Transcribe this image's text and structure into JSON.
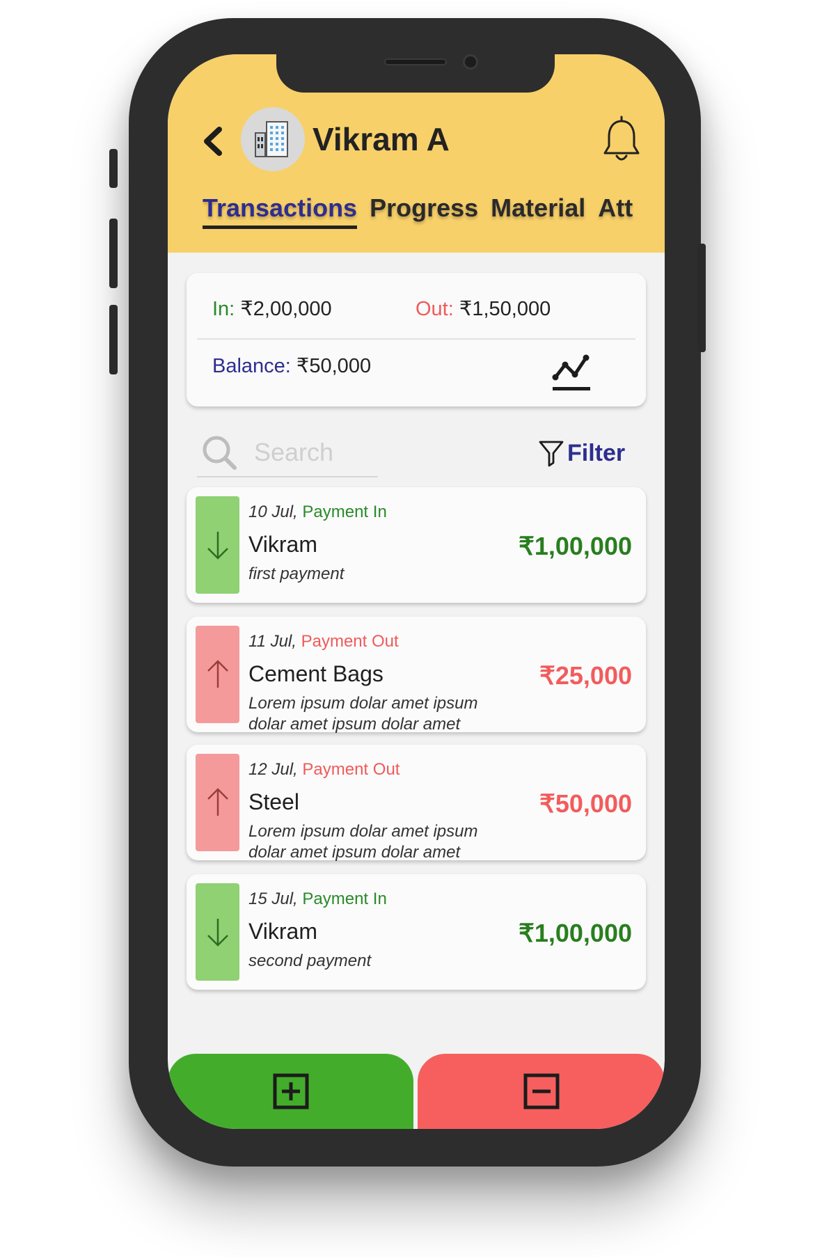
{
  "header": {
    "title": "Vikram A",
    "tabs": [
      {
        "label": "Transactions",
        "active": true
      },
      {
        "label": "Progress",
        "active": false
      },
      {
        "label": "Material",
        "active": false
      },
      {
        "label": "Att",
        "active": false
      }
    ],
    "color": "#f8d06a"
  },
  "summary": {
    "in_label": "In:",
    "in_value": "₹2,00,000",
    "out_label": "Out:",
    "out_value": "₹1,50,000",
    "balance_label": "Balance:",
    "balance_value": "₹50,000"
  },
  "search": {
    "placeholder": "Search"
  },
  "filter": {
    "label": "Filter"
  },
  "transactions": [
    {
      "date": "10 Jul,",
      "type": "Payment In",
      "direction": "in",
      "name": "Vikram",
      "note": "first payment",
      "amount": "₹1,00,000"
    },
    {
      "date": "11 Jul,",
      "type": "Payment Out",
      "direction": "out",
      "name": "Cement Bags",
      "note": "Lorem ipsum dolar amet ipsum dolar amet ipsum dolar amet",
      "amount": "₹25,000"
    },
    {
      "date": "12 Jul,",
      "type": "Payment Out",
      "direction": "out",
      "name": "Steel",
      "note": "Lorem ipsum dolar amet ipsum dolar amet ipsum dolar amet",
      "amount": "₹50,000"
    },
    {
      "date": "15 Jul,",
      "type": "Payment In",
      "direction": "in",
      "name": "Vikram",
      "note": "second payment",
      "amount": "₹1,00,000"
    }
  ],
  "colors": {
    "in_text": "#2a8a2a",
    "in_amount": "#287e1e",
    "in_strip": "#8fd173",
    "out_text": "#f05a5a",
    "out_amount": "#f25c5c",
    "out_strip": "#f59a9a",
    "accent": "#2e2d8f",
    "add_button": "#43ad2b",
    "subtract_button": "#f75e5e"
  },
  "icons": {
    "back": "chevron-left-icon",
    "avatar": "building-icon",
    "bell": "bell-icon",
    "chart": "trend-chart-icon",
    "search": "search-icon",
    "filter": "filter-icon",
    "in": "arrow-down-icon",
    "out": "arrow-up-icon",
    "add": "plus-square-icon",
    "subtract": "minus-square-icon"
  }
}
